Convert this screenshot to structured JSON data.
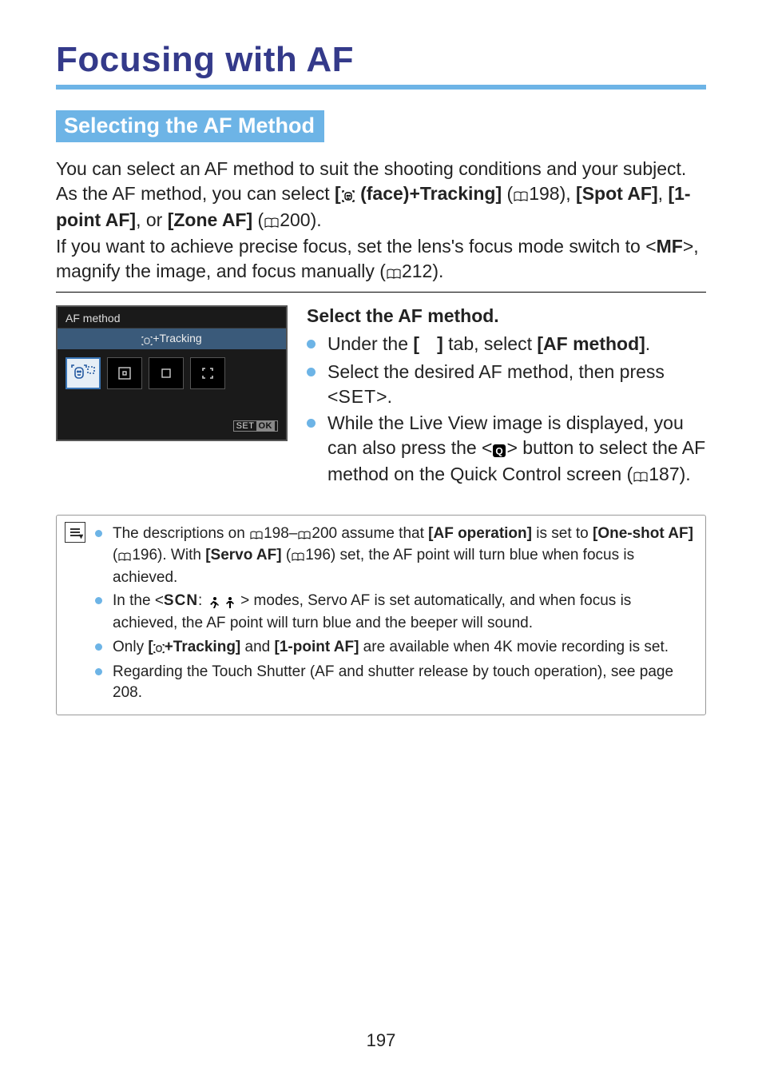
{
  "page_number": "197",
  "title": "Focusing with AF",
  "section_heading": "Selecting the AF Method",
  "intro": {
    "p1a": "You can select an AF method to suit the shooting conditions and your subject. As the AF method, you can select ",
    "face_tracking_label": " (face)+Tracking]",
    "ref198": "198",
    "p1b": "), ",
    "spot_af": "[Spot AF]",
    "comma1": ", ",
    "one_point_af": "[1-point AF]",
    "comma_or": ", or ",
    "zone_af": "[Zone AF]",
    "ref200": "200",
    "p2a": "If you want to achieve precise focus, set the lens's focus mode switch to <",
    "mf": "MF",
    "p2b": ">, magnify the image, and focus manually (",
    "ref212": "212",
    "p2c": ")."
  },
  "camera_screen": {
    "header": "AF method",
    "subheader_suffix": "+Tracking",
    "set_label": "SET",
    "ok_label": "OK"
  },
  "instructions": {
    "heading": "Select the AF method.",
    "b1a": "Under the ",
    "b1_tab": "]",
    "b1b": " tab, select ",
    "b1_afmethod": "[AF method]",
    "b1c": ".",
    "b2a": "Select the desired AF method, then press <",
    "set_text": "SET",
    "b2b": ">.",
    "b3a": "While the Live View image is displayed, you can also press the <",
    "b3b": "> button to select the AF method on the Quick Control screen (",
    "ref187": "187",
    "b3c": ")."
  },
  "notes": {
    "n1a": "The descriptions on ",
    "ref198": "198",
    "dash": "–",
    "ref200": "200",
    "n1b": " assume that ",
    "af_operation": "[AF operation]",
    "n1c": " is set to ",
    "one_shot_af": "[One-shot AF]",
    "n1d": " (",
    "ref196a": "196",
    "n1e": "). With ",
    "servo_af": "[Servo AF]",
    "n1f": " (",
    "ref196b": "196",
    "n1g": ") set, the AF point will turn blue when focus is achieved.",
    "n2a": "In the <",
    "scn": "SCN",
    "n2b": "> modes, Servo AF is set automatically, and when focus is achieved, the AF point will turn blue and the beeper will sound.",
    "n3a": "Only ",
    "face_tracking2": "+Tracking]",
    "n3b": " and ",
    "one_point_af2": "[1-point AF]",
    "n3c": " are available when 4K movie recording is set.",
    "n4": "Regarding the Touch Shutter (AF and shutter release by touch operation), see page 208."
  }
}
